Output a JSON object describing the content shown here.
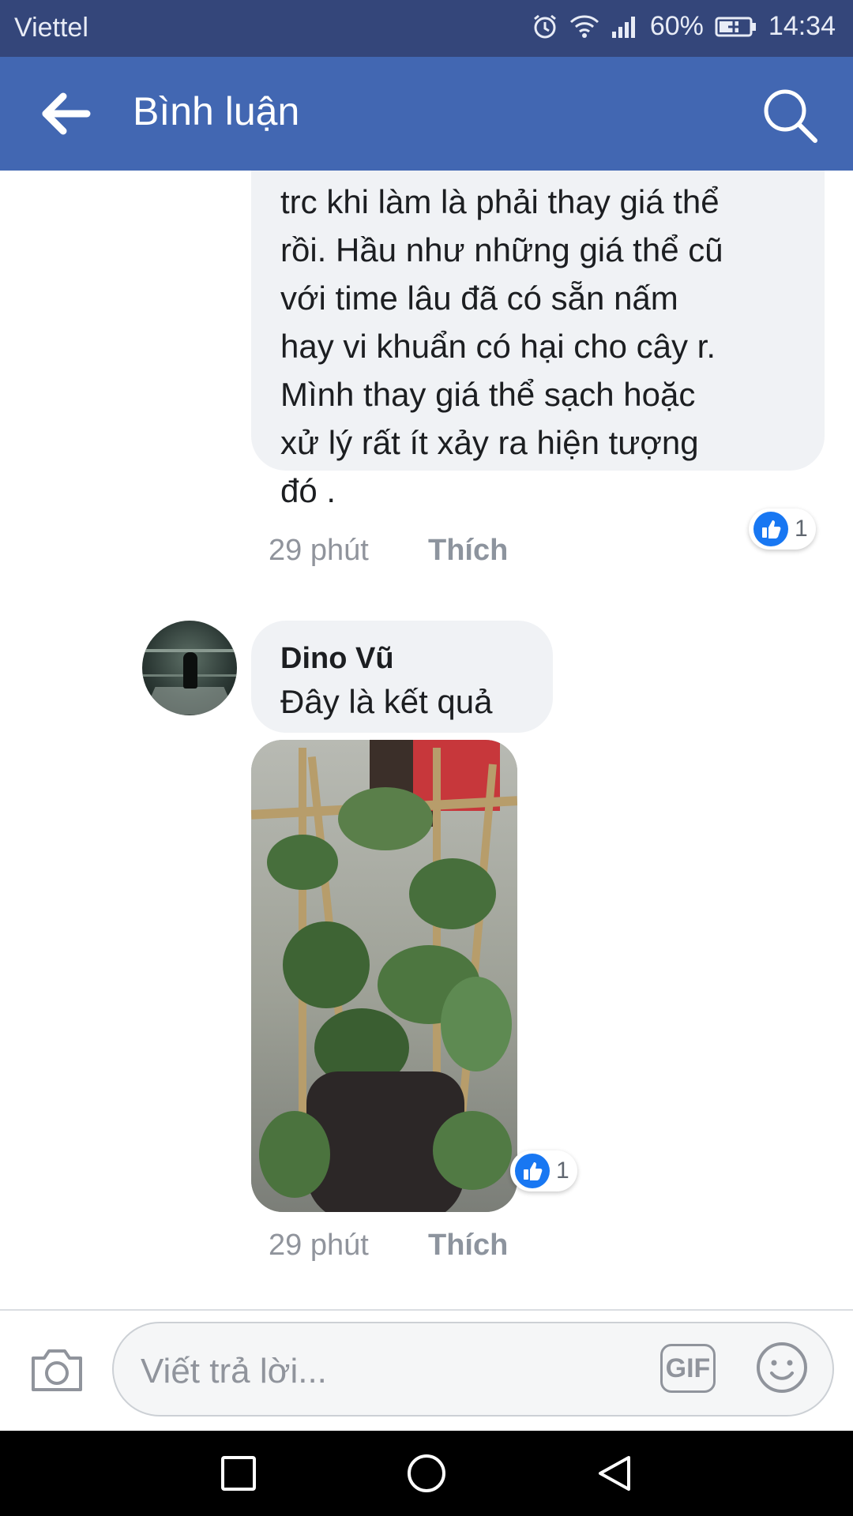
{
  "status_bar": {
    "carrier": "Viettel",
    "battery": "60%",
    "time": "14:34"
  },
  "app_bar": {
    "title": "Bình luận"
  },
  "comments": [
    {
      "text_lines": [
        "trc khi làm là phải thay giá thể",
        "rồi. Hầu như những giá thể cũ",
        "với time lâu đã có sẵn nấm",
        "hay vi khuẩn có hại cho cây r.",
        "Mình thay giá thể sạch hoặc",
        "xử lý rất ít xảy ra hiện tượng",
        "đó ."
      ],
      "reaction_count": "1",
      "time": "29 phút",
      "like_label": "Thích"
    },
    {
      "author": "Dino Vũ",
      "text": "Đây là kết quả",
      "reaction_count": "1",
      "time": "29 phút",
      "like_label": "Thích"
    }
  ],
  "reply_bar": {
    "placeholder": "Viết trả lời...",
    "gif_label": "GIF"
  },
  "icons": {
    "back": "back-arrow-icon",
    "search": "search-icon",
    "camera": "camera-icon",
    "emoji": "emoji-icon",
    "like": "thumbs-up-icon"
  },
  "colors": {
    "status_bar": "#34467a",
    "app_bar": "#4267b2",
    "like_blue": "#1877f2",
    "bubble": "#f0f2f5"
  }
}
